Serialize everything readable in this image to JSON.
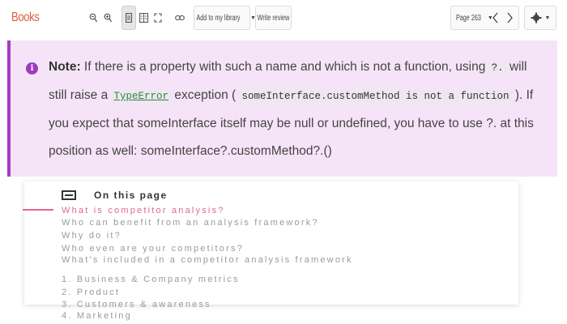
{
  "app": {
    "brand": "Books"
  },
  "toolbar": {
    "zoom_out_icon": "zoom-out-icon",
    "zoom_in_icon": "zoom-in-icon",
    "add_library_label": "Add to my library",
    "write_review_label": "Write review",
    "page_select_label": "Page 263"
  },
  "note": {
    "prefix": "Note:",
    "text1": " If there is a property with such a name and which is not a function, using ",
    "code1": "?.",
    "text2": " will still raise a ",
    "code2": "TypeError",
    "text3": " exception ( ",
    "code3": "someInterface.customMethod is not a function",
    "text4": " ). If you expect that someInterface itself may be null or undefined, you have to use ?. at this position as well: someInterface?.customMethod?.()"
  },
  "toc": {
    "title": "On this page",
    "items": [
      "What is competitor analysis?",
      "Who can benefit from an analysis framework?",
      "Why do it?",
      "Who even are your competitors?",
      "What's included in a competitor analysis framework",
      "1. Business & Company metrics",
      "2. Product",
      "3. Customers & awareness",
      "4. Marketing"
    ]
  },
  "colors": {
    "brand": "#d9603a",
    "note_background": "#f5e4f7",
    "note_border": "#a43cc4",
    "toc_active": "#e26a86"
  }
}
